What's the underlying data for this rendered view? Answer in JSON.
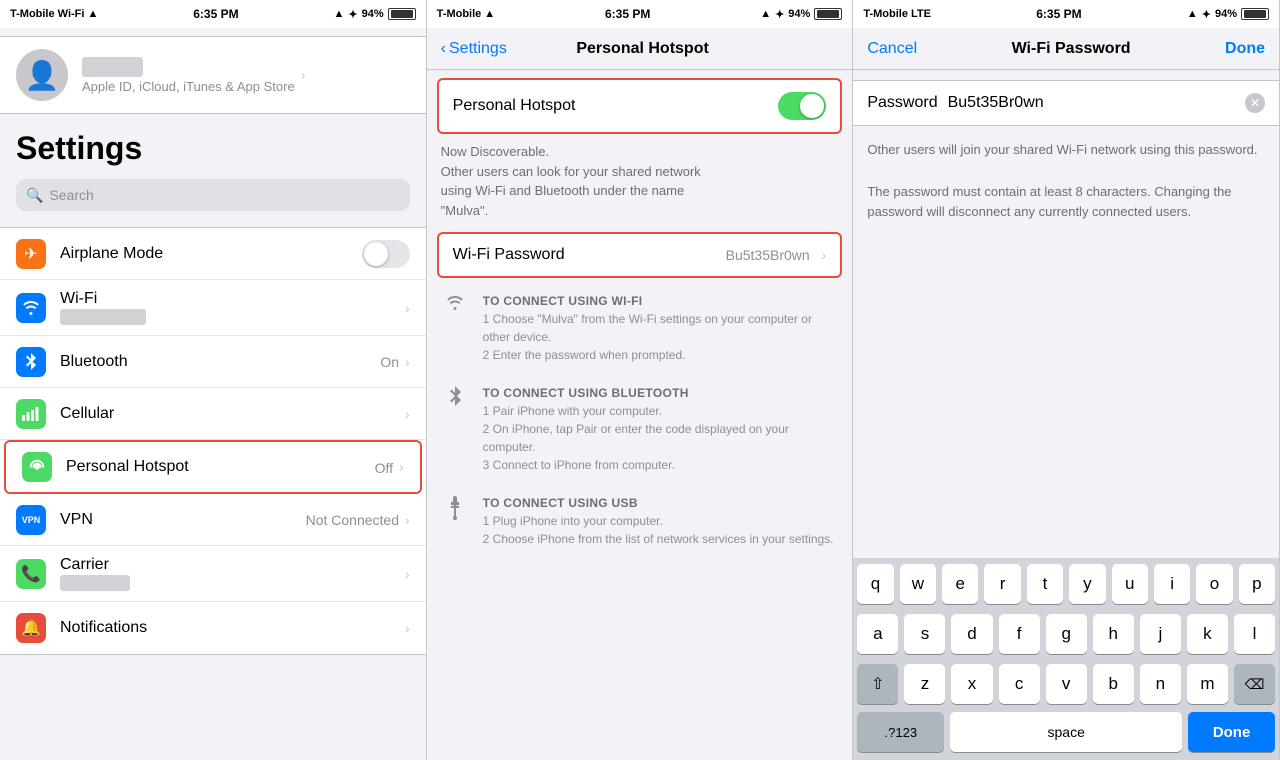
{
  "panel1": {
    "status": {
      "carrier": "T-Mobile Wi-Fi",
      "time": "6:35 PM",
      "battery": "94%"
    },
    "title": "Settings",
    "search_placeholder": "Search",
    "profile": {
      "sub": "Apple ID, iCloud, iTunes & App Store"
    },
    "rows": [
      {
        "label": "Airplane Mode",
        "icon_char": "✈",
        "icon_color": "#f97316",
        "value": "",
        "show_toggle": true
      },
      {
        "label": "Wi-Fi",
        "icon_char": "📶",
        "icon_color": "#007aff",
        "value": "blurred"
      },
      {
        "label": "Bluetooth",
        "icon_char": "B",
        "icon_color": "#007aff",
        "value": "On"
      },
      {
        "label": "Cellular",
        "icon_char": "◉",
        "icon_color": "#4cd964",
        "value": ""
      },
      {
        "label": "Personal Hotspot",
        "icon_char": "⛓",
        "icon_color": "#4cd964",
        "value": "Off",
        "highlighted": true
      },
      {
        "label": "VPN",
        "icon_char": "VPN",
        "icon_color": "#007aff",
        "value": "Not Connected"
      },
      {
        "label": "Carrier",
        "icon_char": "📞",
        "icon_color": "#4cd964",
        "value": "blurred"
      },
      {
        "label": "Notifications",
        "icon_char": "🔔",
        "icon_color": "#e74c3c",
        "value": ""
      }
    ]
  },
  "panel2": {
    "status": {
      "carrier": "T-Mobile",
      "time": "6:35 PM",
      "battery": "94%"
    },
    "nav_back": "Settings",
    "nav_title": "Personal Hotspot",
    "hotspot_label": "Personal Hotspot",
    "hotspot_desc": "Now Discoverable.\nOther users can look for your shared network\nusing Wi-Fi and Bluetooth under the name\n\"Mulva\".",
    "wifi_password_label": "Wi-Fi Password",
    "wifi_password_value": "Bu5t35Br0wn",
    "connect_sections": [
      {
        "icon": "wifi",
        "title": "TO CONNECT USING WI-FI",
        "steps": [
          "1 Choose \"Mulva\" from the Wi-Fi settings on your computer or other device.",
          "2 Enter the password when prompted."
        ]
      },
      {
        "icon": "bluetooth",
        "title": "TO CONNECT USING BLUETOOTH",
        "steps": [
          "1 Pair iPhone with your computer.",
          "2 On iPhone, tap Pair or enter the code displayed on your computer.",
          "3 Connect to iPhone from computer."
        ]
      },
      {
        "icon": "usb",
        "title": "TO CONNECT USING USB",
        "steps": [
          "1 Plug iPhone into your computer.",
          "2 Choose iPhone from the list of network services in your settings."
        ]
      }
    ]
  },
  "panel3": {
    "status": {
      "carrier": "T-Mobile LTE",
      "time": "6:35 PM",
      "battery": "94%"
    },
    "nav_cancel": "Cancel",
    "nav_title": "Wi-Fi Password",
    "nav_done": "Done",
    "password_label": "Password",
    "password_value": "Bu5t35Br0wn",
    "hint": "Other users will join your shared Wi-Fi network using this password.\n\nThe password must contain at least 8 characters. Changing the password will disconnect any currently connected users.",
    "keyboard": {
      "rows": [
        [
          "q",
          "w",
          "e",
          "r",
          "t",
          "y",
          "u",
          "i",
          "o",
          "p"
        ],
        [
          "a",
          "s",
          "d",
          "f",
          "g",
          "h",
          "j",
          "k",
          "l"
        ],
        [
          "⇧",
          "z",
          "x",
          "c",
          "v",
          "b",
          "n",
          "m",
          "⌫"
        ],
        [
          ".?123",
          "space",
          "Done"
        ]
      ]
    }
  }
}
